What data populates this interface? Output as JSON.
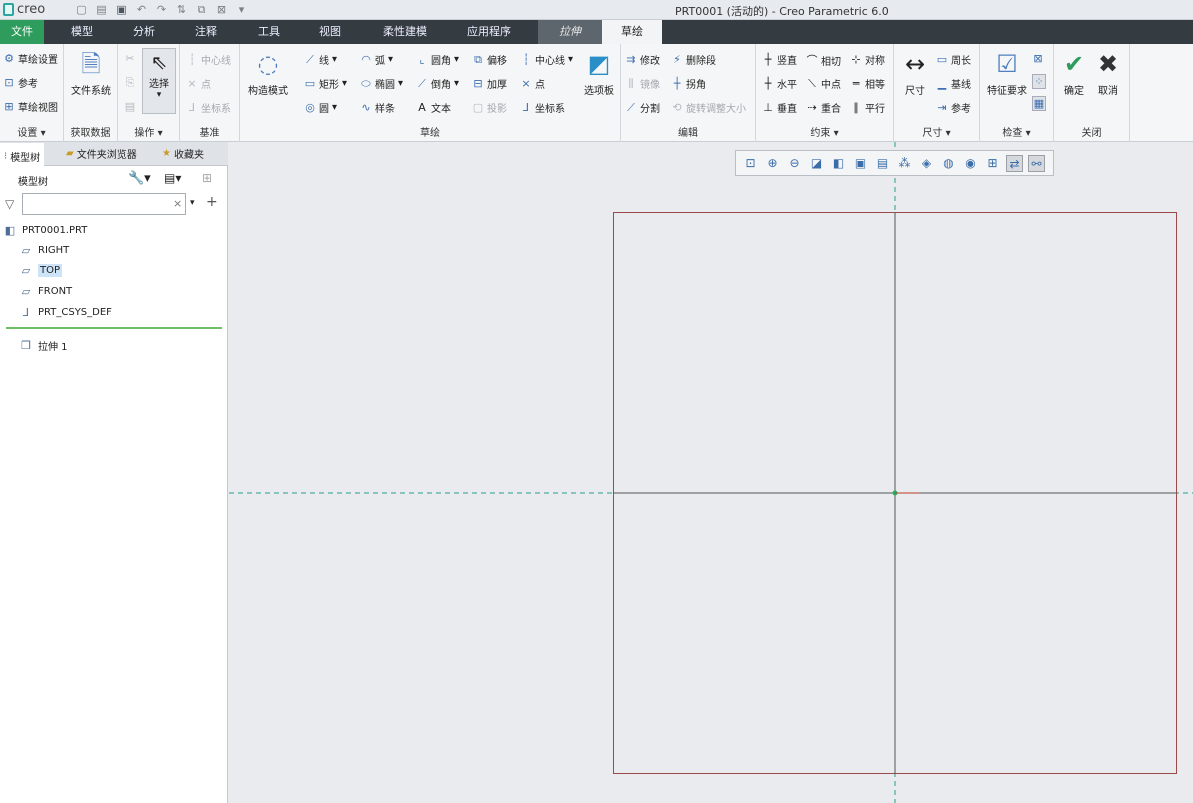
{
  "app": {
    "logo": "creo",
    "window_title": "PRT0001 (活动的) - Creo Parametric 6.0"
  },
  "tabs": [
    "文件",
    "模型",
    "分析",
    "注释",
    "工具",
    "视图",
    "柔性建模",
    "应用程序",
    "拉伸",
    "草绘"
  ],
  "ribbon": {
    "setup": {
      "items": [
        "草绘设置",
        "参考",
        "草绘视图"
      ],
      "label": "设置 ▾"
    },
    "get_data": {
      "big": "文件系统",
      "label": "获取数据"
    },
    "operations": {
      "select": "选择",
      "label": "操作 ▾"
    },
    "datum": {
      "items": [
        "中心线",
        "点",
        "坐标系"
      ],
      "label": "基准"
    },
    "construction": "构造模式",
    "sketching": {
      "items": [
        "线",
        "矩形",
        "圆",
        "弧",
        "椭圆",
        "样条",
        "圆角",
        "倒角",
        "文本",
        "偏移",
        "加厚",
        "投影",
        "中心线",
        "点",
        "坐标系"
      ],
      "palette": "选项板",
      "label": "草绘"
    },
    "editing": {
      "items": [
        "修改",
        "镜像",
        "分割",
        "删除段",
        "拐角",
        "旋转调整大小"
      ],
      "label": "编辑"
    },
    "constrain": {
      "items": [
        "竖直",
        "水平",
        "垂直",
        "相切",
        "中点",
        "重合",
        "对称",
        "相等",
        "平行"
      ],
      "label": "约束 ▾"
    },
    "dimension": {
      "big": "尺寸",
      "items": [
        "周长",
        "基线",
        "参考"
      ],
      "label": "尺寸 ▾"
    },
    "inspect": {
      "big": "特征要求",
      "label": "检查 ▾"
    },
    "close": {
      "ok": "确定",
      "cancel": "取消",
      "label": "关闭"
    }
  },
  "left_panel": {
    "tabs": [
      "模型树",
      "文件夹浏览器",
      "收藏夹"
    ],
    "tree_header": "模型树",
    "filter_placeholder": "",
    "nodes": [
      "PRT0001.PRT",
      "RIGHT",
      "TOP",
      "FRONT",
      "PRT_CSYS_DEF",
      "拉伸 1"
    ]
  },
  "colors": {
    "file_tab": "#2e9c5c",
    "tab_bar": "#343b41",
    "centerline": "#2a9d8f",
    "sketch_rect": "#9b4a4a"
  }
}
